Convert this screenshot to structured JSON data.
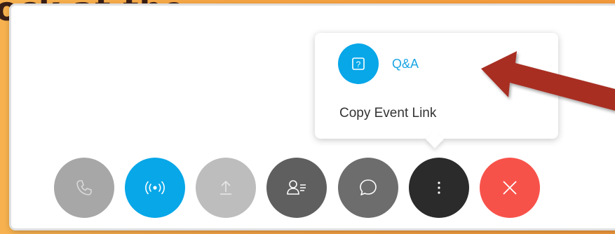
{
  "slide": {
    "partial_text": "ock at the"
  },
  "popup_menu": {
    "items": [
      {
        "label": "Q&A",
        "icon": "question-icon"
      },
      {
        "label": "Copy Event Link"
      }
    ]
  },
  "toolbar": {
    "buttons": [
      {
        "name": "phone",
        "icon": "phone-icon",
        "color": "#a7a7a7",
        "state": "disabled"
      },
      {
        "name": "broadcast",
        "icon": "broadcast-icon",
        "color": "#07a7e8",
        "state": "active"
      },
      {
        "name": "share",
        "icon": "upload-icon",
        "color": "#bdbdbd",
        "state": "disabled"
      },
      {
        "name": "participants",
        "icon": "participants-icon",
        "color": "#5f5f5f",
        "state": "normal"
      },
      {
        "name": "chat",
        "icon": "chat-icon",
        "color": "#6d6d6d",
        "state": "normal"
      },
      {
        "name": "more",
        "icon": "more-vertical-icon",
        "color": "#2b2b2b",
        "state": "open"
      },
      {
        "name": "leave",
        "icon": "close-icon",
        "color": "#f7524a",
        "state": "normal"
      }
    ]
  },
  "annotation": {
    "arrow_color": "#a82d22"
  }
}
